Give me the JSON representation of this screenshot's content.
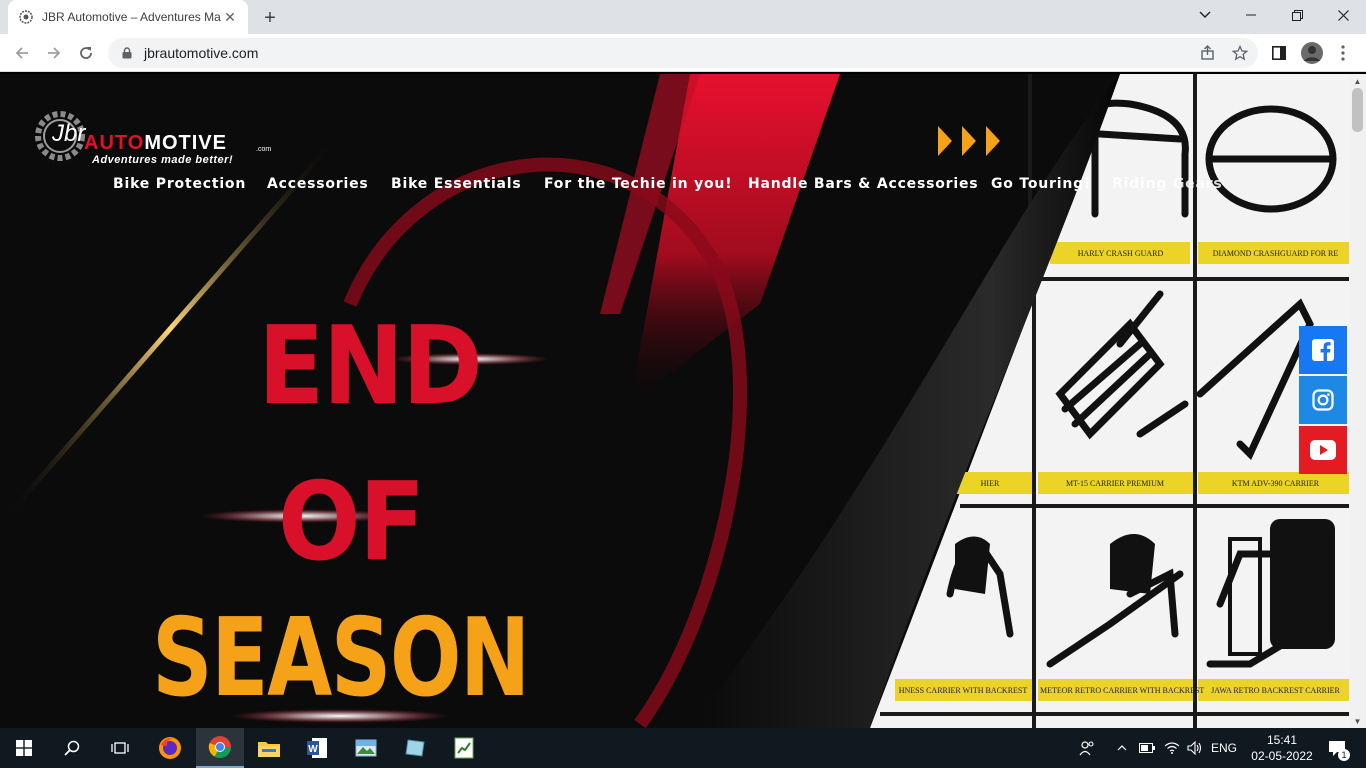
{
  "browser": {
    "tab_title": "JBR Automotive – Adventures Ma",
    "url": "jbrautomotive.com",
    "new_tab_symbol": "+",
    "close_symbol": "✕"
  },
  "logo": {
    "jbr": "Jbr",
    "auto_red": "AUTO",
    "auto_white": "MOTIVE",
    "dotcom": ".com",
    "tagline": "Adventures made better!"
  },
  "nav": {
    "items": [
      "Bike Protection",
      "Accessories",
      "Bike Essentials",
      "For the Techie in you!",
      "Handle Bars & Accessories",
      "Go Touring!",
      "Riding Gears"
    ]
  },
  "hero": {
    "line1": "END",
    "line2": "OF",
    "line3": "SEASON",
    "colors": {
      "red": "#d8102a",
      "orange": "#f5a219"
    }
  },
  "products": [
    "HARLY CRASH GUARD",
    "DIAMOND CRASHGUARD FOR RE",
    "HIER",
    "MT-15 CARRIER PREMIUM",
    "KTM ADV-390 CARRIER",
    "HNESS CARRIER WITH BACKREST",
    "METEOR RETRO CARRIER WITH BACKREST",
    "JAWA RETRO BACKREST CARRIER"
  ],
  "social": [
    {
      "name": "facebook-icon",
      "color": "#1877f2"
    },
    {
      "name": "instagram-icon",
      "color": "#1e88e5"
    },
    {
      "name": "youtube-icon",
      "color": "#e31b23"
    }
  ],
  "taskbar": {
    "language": "ENG",
    "time": "15:41",
    "date": "02-05-2022",
    "notification_count": "1"
  }
}
